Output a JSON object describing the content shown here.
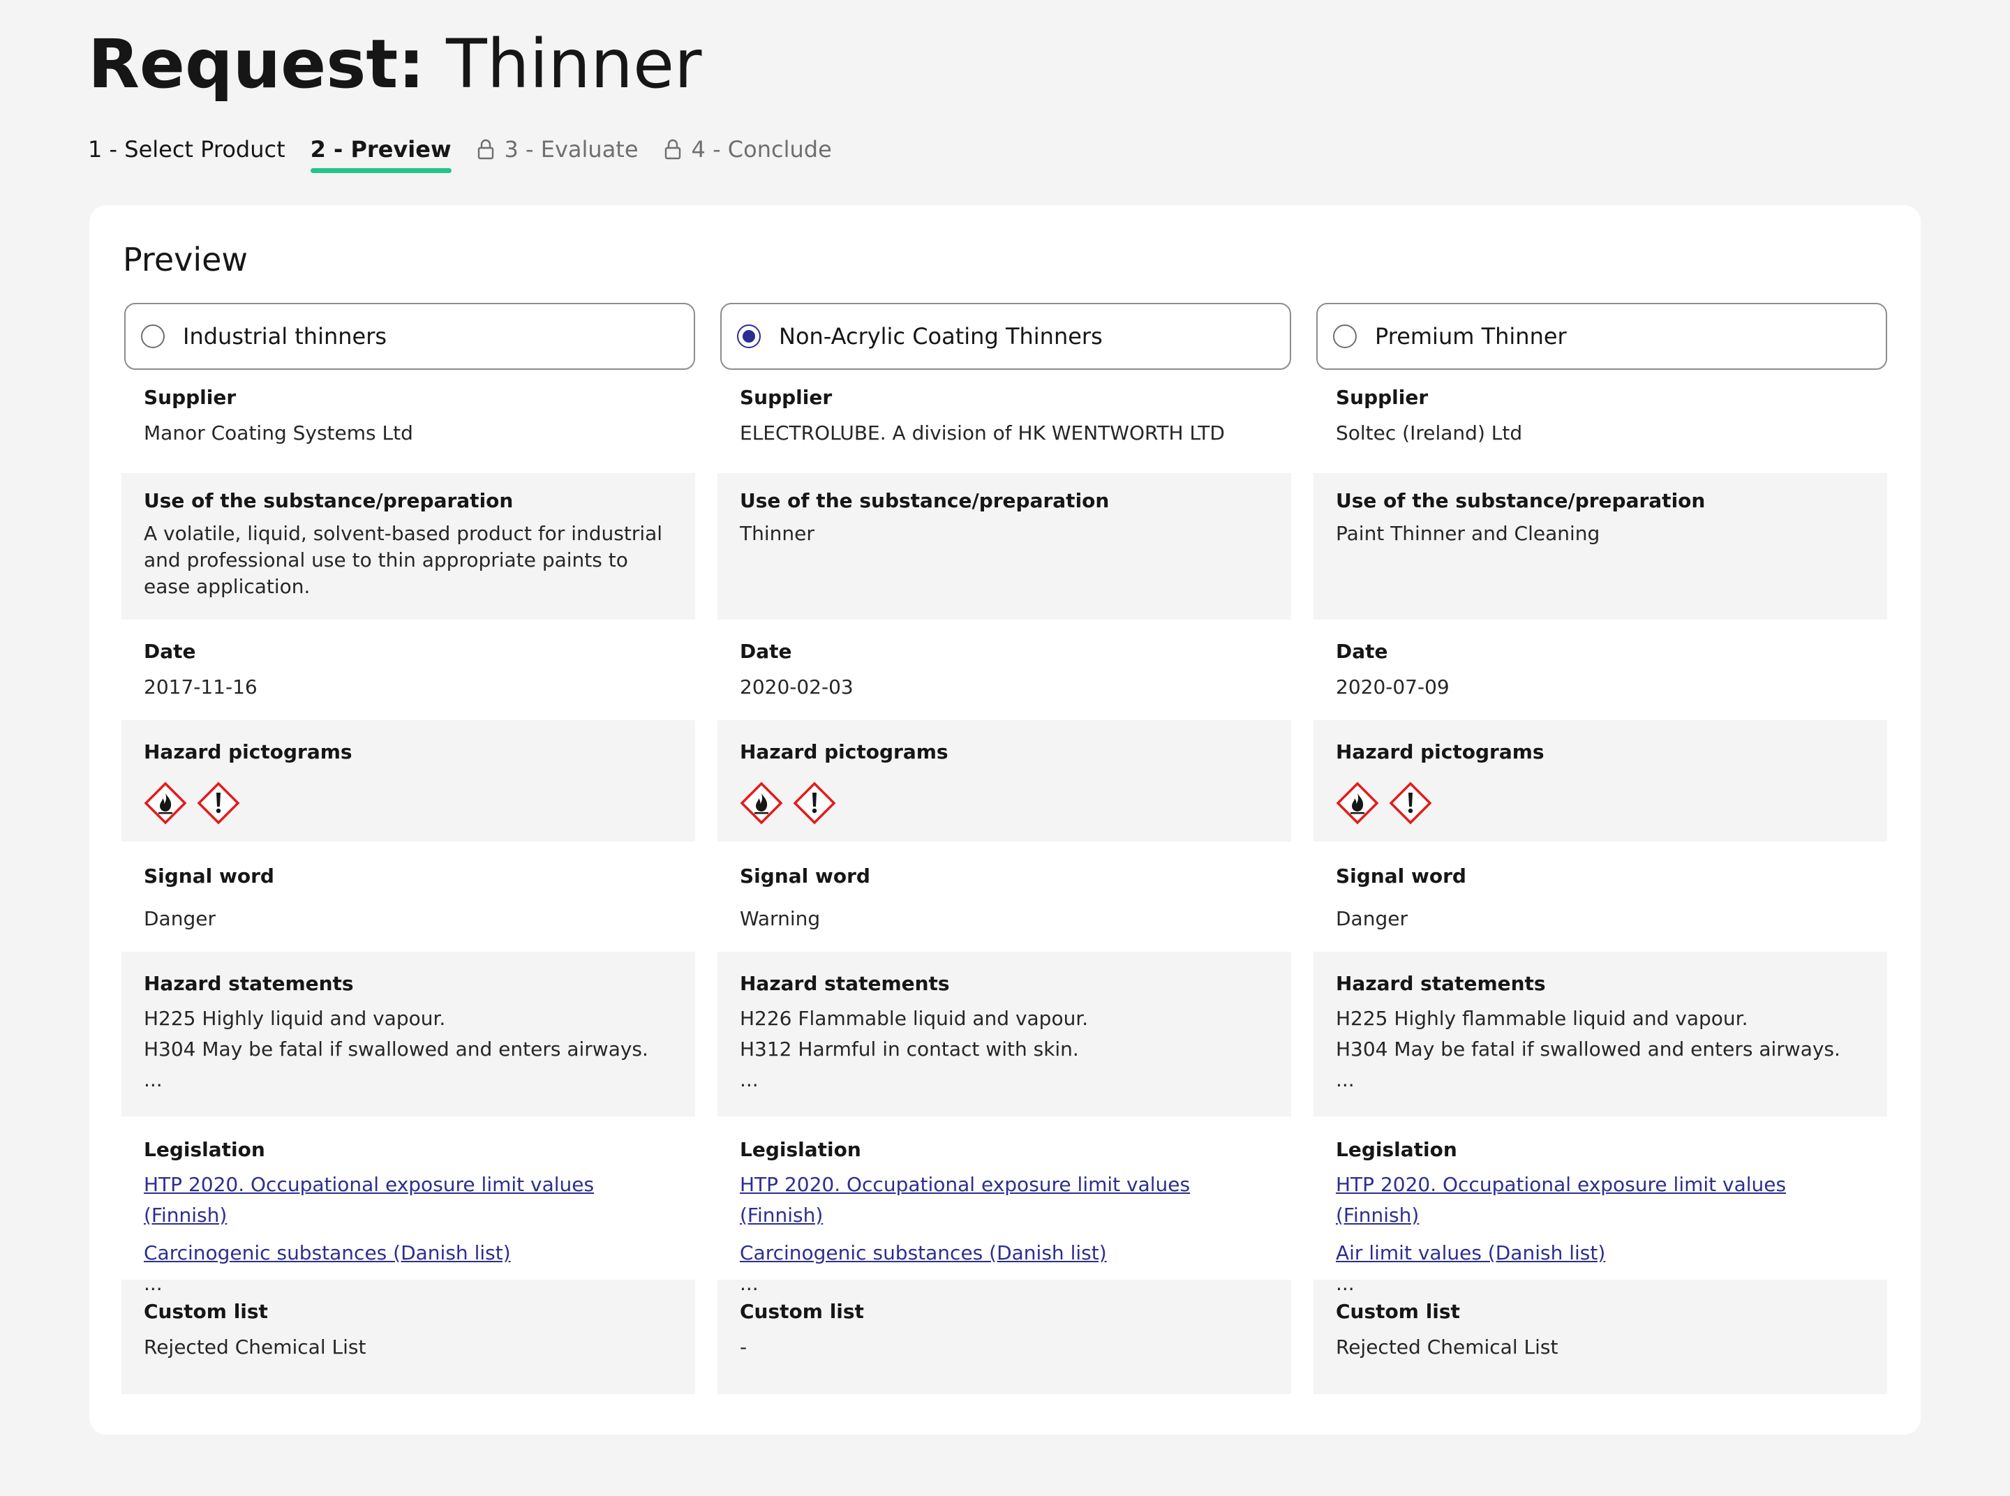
{
  "page": {
    "title_strong": "Request:",
    "title_rest": "Thinner"
  },
  "steps": [
    {
      "label": "1 - Select Product",
      "state": "done"
    },
    {
      "label": "2 - Preview",
      "state": "active"
    },
    {
      "label": "3 - Evaluate",
      "state": "locked"
    },
    {
      "label": "4 - Conclude",
      "state": "locked"
    }
  ],
  "colors": {
    "active_underline": "#24c48a",
    "radio_selected": "#2b2f8f",
    "link": "#2c2f8f",
    "hazard_red": "#e31b1b"
  },
  "preview": {
    "title": "Preview",
    "labels": {
      "supplier": "Supplier",
      "use": "Use of the substance/preparation",
      "date": "Date",
      "pictograms": "Hazard pictograms",
      "signal": "Signal word",
      "hazard_statements": "Hazard statements",
      "legislation": "Legislation",
      "custom_list": "Custom list"
    },
    "products": [
      {
        "name": "Industrial thinners",
        "selected": false,
        "supplier": "Manor Coating Systems Ltd",
        "use": "A volatile, liquid, solvent-based product for industrial and professional use to thin appropriate paints to ease application.",
        "date": "2017-11-16",
        "pictograms": [
          "flame-pictogram-icon",
          "exclamation-pictogram-icon"
        ],
        "signal_word": "Danger",
        "hazard_statements": [
          "H225 Highly liquid and vapour.",
          "H304 May be fatal if swallowed and enters airways.",
          "..."
        ],
        "legislation": [
          "HTP 2020. Occupational exposure limit values (Finnish)",
          "Carcinogenic substances (Danish list)"
        ],
        "legislation_more": "...",
        "custom_list": "Rejected Chemical List"
      },
      {
        "name": "Non-Acrylic Coating Thinners",
        "selected": true,
        "supplier": "ELECTROLUBE. A division of HK WENTWORTH LTD",
        "use": "Thinner",
        "date": "2020-02-03",
        "pictograms": [
          "flame-pictogram-icon",
          "exclamation-pictogram-icon"
        ],
        "signal_word": "Warning",
        "hazard_statements": [
          "H226 Flammable liquid and vapour.",
          "H312 Harmful in contact with skin.",
          "..."
        ],
        "legislation": [
          "HTP 2020. Occupational exposure limit values (Finnish)",
          "Carcinogenic substances (Danish list)"
        ],
        "legislation_more": "...",
        "custom_list": "-"
      },
      {
        "name": "Premium Thinner",
        "selected": false,
        "supplier": "Soltec (Ireland) Ltd",
        "use": "Paint Thinner and Cleaning",
        "date": "2020-07-09",
        "pictograms": [
          "flame-pictogram-icon",
          "exclamation-pictogram-icon"
        ],
        "signal_word": "Danger",
        "hazard_statements": [
          "H225 Highly flammable liquid and vapour.",
          "H304 May be fatal if swallowed and enters airways.",
          "..."
        ],
        "legislation": [
          "HTP 2020. Occupational exposure limit values (Finnish)",
          "Air limit values (Danish list)"
        ],
        "legislation_more": "...",
        "custom_list": "Rejected Chemical List"
      }
    ]
  }
}
